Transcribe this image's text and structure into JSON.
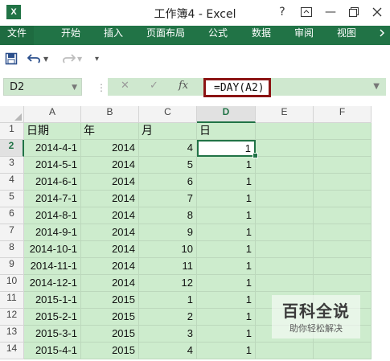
{
  "window": {
    "title": "工作簿4 - Excel",
    "app_icon": "X",
    "help": "?",
    "restore": "⧉",
    "minimize": "—",
    "maximize": "□"
  },
  "ribbon": {
    "tabs": [
      "文件",
      "开始",
      "插入",
      "页面布局",
      "公式",
      "数据",
      "审阅",
      "视图"
    ],
    "active_tab": "文件",
    "accent": "#217346"
  },
  "qat": {
    "save_icon": "save-icon",
    "undo_icon": "undo-icon",
    "redo_icon": "redo-icon",
    "customize": "▾"
  },
  "formula_bar": {
    "name_box": "D2",
    "cancel": "✕",
    "enter": "✓",
    "fx": "fx",
    "formula": "=DAY(A2)",
    "highlight_color": "#8c1414"
  },
  "sheet": {
    "columns": [
      "A",
      "B",
      "C",
      "D",
      "E",
      "F"
    ],
    "selected_column": "D",
    "selected_row": "2",
    "rows": [
      {
        "n": "1",
        "a": "日期",
        "b": "年",
        "c": "月",
        "d": "日"
      },
      {
        "n": "2",
        "a": "2014-4-1",
        "b": "2014",
        "c": "4",
        "d": "1"
      },
      {
        "n": "3",
        "a": "2014-5-1",
        "b": "2014",
        "c": "5",
        "d": "1"
      },
      {
        "n": "4",
        "a": "2014-6-1",
        "b": "2014",
        "c": "6",
        "d": "1"
      },
      {
        "n": "5",
        "a": "2014-7-1",
        "b": "2014",
        "c": "7",
        "d": "1"
      },
      {
        "n": "6",
        "a": "2014-8-1",
        "b": "2014",
        "c": "8",
        "d": "1"
      },
      {
        "n": "7",
        "a": "2014-9-1",
        "b": "2014",
        "c": "9",
        "d": "1"
      },
      {
        "n": "8",
        "a": "2014-10-1",
        "b": "2014",
        "c": "10",
        "d": "1"
      },
      {
        "n": "9",
        "a": "2014-11-1",
        "b": "2014",
        "c": "11",
        "d": "1"
      },
      {
        "n": "10",
        "a": "2014-12-1",
        "b": "2014",
        "c": "12",
        "d": "1"
      },
      {
        "n": "11",
        "a": "2015-1-1",
        "b": "2015",
        "c": "1",
        "d": "1"
      },
      {
        "n": "12",
        "a": "2015-2-1",
        "b": "2015",
        "c": "2",
        "d": "1"
      },
      {
        "n": "13",
        "a": "2015-3-1",
        "b": "2015",
        "c": "3",
        "d": "1"
      },
      {
        "n": "14",
        "a": "2015-4-1",
        "b": "2015",
        "c": "4",
        "d": "1"
      }
    ]
  },
  "watermark": {
    "title": "百科全说",
    "subtitle": "助你轻松解决"
  }
}
